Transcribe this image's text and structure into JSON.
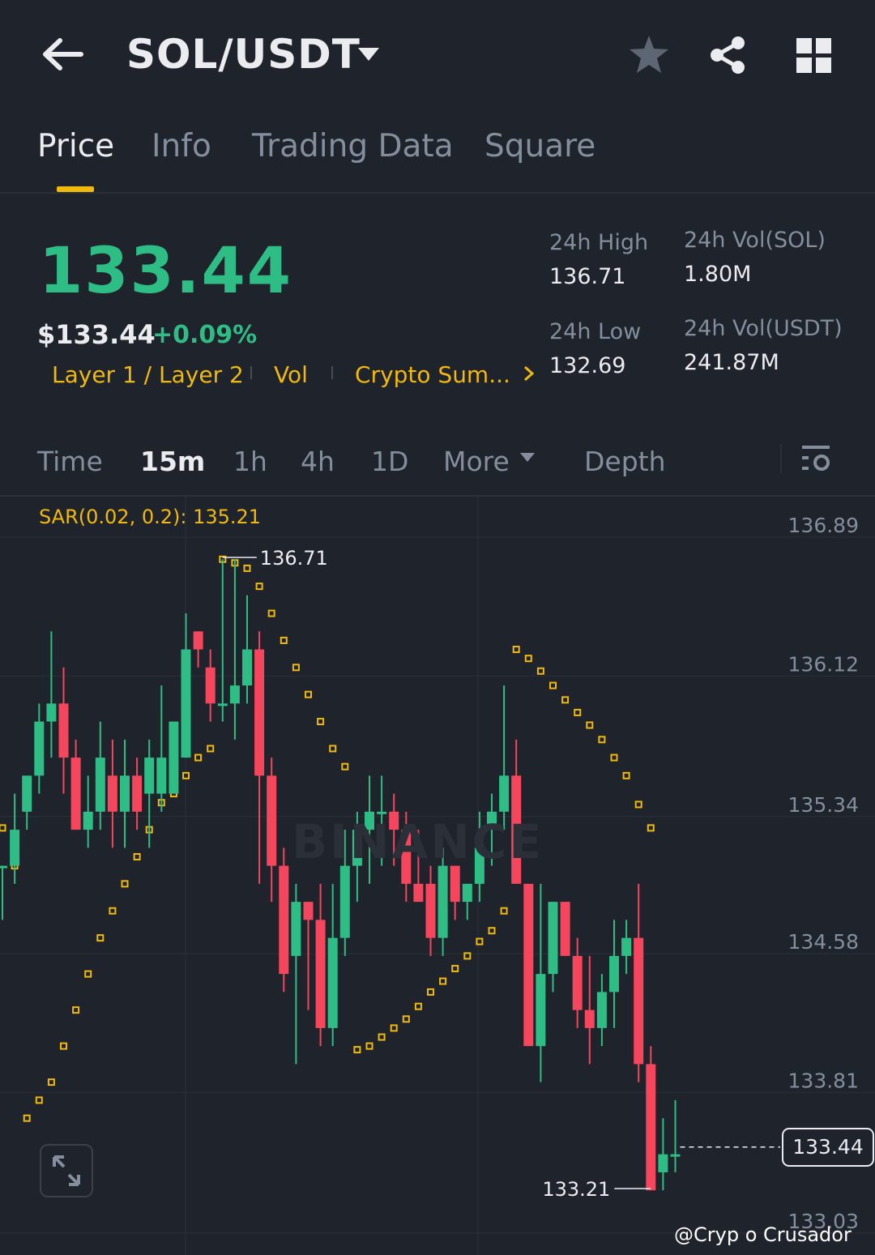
{
  "header": {
    "pair": "SOL/USDT",
    "icons": [
      "back-arrow-icon",
      "dropdown-caret-icon",
      "star-icon",
      "share-icon",
      "grid-menu-icon"
    ]
  },
  "tabs": [
    {
      "label": "Price",
      "active": true
    },
    {
      "label": "Info",
      "active": false
    },
    {
      "label": "Trading Data",
      "active": false
    },
    {
      "label": "Square",
      "active": false
    }
  ],
  "ticker": {
    "last_price": "133.44",
    "usd_price": "$133.44",
    "change": "+0.09%",
    "tags": [
      "Layer 1 / Layer 2",
      "Vol",
      "Crypto Sum..."
    ],
    "stats": {
      "high_label": "24h High",
      "high_value": "136.71",
      "low_label": "24h Low",
      "low_value": "132.69",
      "vol_sol_label": "24h Vol(SOL)",
      "vol_sol_value": "1.80M",
      "vol_usdt_label": "24h Vol(USDT)",
      "vol_usdt_value": "241.87M"
    }
  },
  "intervals": [
    {
      "label": "Time",
      "active": false
    },
    {
      "label": "15m",
      "active": true
    },
    {
      "label": "1h",
      "active": false
    },
    {
      "label": "4h",
      "active": false
    },
    {
      "label": "1D",
      "active": false
    },
    {
      "label": "More",
      "active": false
    },
    {
      "label": "Depth",
      "active": false
    }
  ],
  "colors": {
    "up": "#2ebd85",
    "down": "#f6465d",
    "accent": "#f0b90b",
    "bg": "#1f232b"
  },
  "chart_data": {
    "type": "candlestick",
    "indicator": "SAR(0.02, 0.2): 135.21",
    "y_ticks": [
      "136.89",
      "136.12",
      "135.34",
      "134.58",
      "133.81",
      "133.03"
    ],
    "ylim": [
      132.95,
      137.08
    ],
    "high_marker": "136.71",
    "low_marker": "133.21",
    "current_price": "133.44",
    "candles": [
      {
        "o": 135.0,
        "h": 135.0,
        "l": 134.7,
        "c": 135.0
      },
      {
        "o": 135.0,
        "h": 135.4,
        "l": 134.9,
        "c": 135.2
      },
      {
        "o": 135.3,
        "h": 135.5,
        "l": 135.2,
        "c": 135.5
      },
      {
        "o": 135.5,
        "h": 135.9,
        "l": 135.4,
        "c": 135.8
      },
      {
        "o": 135.8,
        "h": 136.3,
        "l": 135.6,
        "c": 135.9
      },
      {
        "o": 135.9,
        "h": 136.1,
        "l": 135.4,
        "c": 135.6
      },
      {
        "o": 135.6,
        "h": 135.7,
        "l": 135.2,
        "c": 135.2
      },
      {
        "o": 135.2,
        "h": 135.5,
        "l": 135.1,
        "c": 135.3
      },
      {
        "o": 135.3,
        "h": 135.8,
        "l": 135.2,
        "c": 135.6
      },
      {
        "o": 135.5,
        "h": 135.7,
        "l": 135.1,
        "c": 135.3
      },
      {
        "o": 135.3,
        "h": 135.7,
        "l": 135.1,
        "c": 135.5
      },
      {
        "o": 135.5,
        "h": 135.6,
        "l": 135.2,
        "c": 135.3
      },
      {
        "o": 135.4,
        "h": 135.7,
        "l": 135.1,
        "c": 135.6
      },
      {
        "o": 135.4,
        "h": 136.0,
        "l": 135.3,
        "c": 135.6
      },
      {
        "o": 135.4,
        "h": 135.8,
        "l": 135.4,
        "c": 135.8
      },
      {
        "o": 135.6,
        "h": 136.4,
        "l": 135.6,
        "c": 136.2
      },
      {
        "o": 136.3,
        "h": 136.3,
        "l": 136.1,
        "c": 136.2
      },
      {
        "o": 136.1,
        "h": 136.2,
        "l": 135.8,
        "c": 135.9
      },
      {
        "o": 135.9,
        "h": 136.7,
        "l": 135.8,
        "c": 135.9
      },
      {
        "o": 135.9,
        "h": 136.7,
        "l": 135.7,
        "c": 136.0
      },
      {
        "o": 136.0,
        "h": 136.5,
        "l": 135.9,
        "c": 136.2
      },
      {
        "o": 136.2,
        "h": 136.3,
        "l": 134.9,
        "c": 135.5
      },
      {
        "o": 135.5,
        "h": 135.6,
        "l": 134.8,
        "c": 135.0
      },
      {
        "o": 135.0,
        "h": 135.1,
        "l": 134.3,
        "c": 134.4
      },
      {
        "o": 134.5,
        "h": 134.9,
        "l": 133.9,
        "c": 134.8
      },
      {
        "o": 134.8,
        "h": 134.8,
        "l": 134.2,
        "c": 134.7
      },
      {
        "o": 134.7,
        "h": 134.9,
        "l": 134.0,
        "c": 134.1
      },
      {
        "o": 134.1,
        "h": 134.9,
        "l": 134.0,
        "c": 134.6
      },
      {
        "o": 134.6,
        "h": 135.2,
        "l": 134.5,
        "c": 135.0
      },
      {
        "o": 135.0,
        "h": 135.3,
        "l": 134.8,
        "c": 135.2
      },
      {
        "o": 135.2,
        "h": 135.5,
        "l": 134.9,
        "c": 135.3
      },
      {
        "o": 135.3,
        "h": 135.5,
        "l": 135.0,
        "c": 135.3
      },
      {
        "o": 135.3,
        "h": 135.4,
        "l": 135.0,
        "c": 135.2
      },
      {
        "o": 135.2,
        "h": 135.3,
        "l": 134.8,
        "c": 134.9
      },
      {
        "o": 134.9,
        "h": 135.2,
        "l": 134.8,
        "c": 134.8
      },
      {
        "o": 134.9,
        "h": 135.0,
        "l": 134.5,
        "c": 134.6
      },
      {
        "o": 134.6,
        "h": 135.1,
        "l": 134.5,
        "c": 135.0
      },
      {
        "o": 135.0,
        "h": 135.0,
        "l": 134.7,
        "c": 134.8
      },
      {
        "o": 134.8,
        "h": 134.9,
        "l": 134.7,
        "c": 134.9
      },
      {
        "o": 134.9,
        "h": 135.3,
        "l": 134.8,
        "c": 135.1
      },
      {
        "o": 135.2,
        "h": 135.4,
        "l": 135.0,
        "c": 135.3
      },
      {
        "o": 135.3,
        "h": 136.0,
        "l": 135.2,
        "c": 135.5
      },
      {
        "o": 135.5,
        "h": 135.7,
        "l": 134.9,
        "c": 134.9
      },
      {
        "o": 134.9,
        "h": 134.9,
        "l": 134.0,
        "c": 134.0
      },
      {
        "o": 134.0,
        "h": 134.9,
        "l": 133.8,
        "c": 134.4
      },
      {
        "o": 134.4,
        "h": 134.8,
        "l": 134.3,
        "c": 134.8
      },
      {
        "o": 134.8,
        "h": 134.8,
        "l": 134.5,
        "c": 134.5
      },
      {
        "o": 134.5,
        "h": 134.6,
        "l": 134.1,
        "c": 134.2
      },
      {
        "o": 134.2,
        "h": 134.5,
        "l": 133.9,
        "c": 134.1
      },
      {
        "o": 134.1,
        "h": 134.4,
        "l": 134.0,
        "c": 134.3
      },
      {
        "o": 134.3,
        "h": 134.7,
        "l": 134.1,
        "c": 134.5
      },
      {
        "o": 134.5,
        "h": 134.7,
        "l": 134.4,
        "c": 134.6
      },
      {
        "o": 134.6,
        "h": 134.9,
        "l": 133.8,
        "c": 133.9
      },
      {
        "o": 133.9,
        "h": 134.0,
        "l": 133.2,
        "c": 133.2
      },
      {
        "o": 133.3,
        "h": 133.6,
        "l": 133.2,
        "c": 133.4
      },
      {
        "o": 133.4,
        "h": 133.7,
        "l": 133.3,
        "c": 133.4
      }
    ],
    "sar": [
      [
        0,
        135.21
      ],
      [
        1,
        135.0
      ],
      [
        2,
        133.6
      ],
      [
        3,
        133.7
      ],
      [
        4,
        133.8
      ],
      [
        5,
        134.0
      ],
      [
        6,
        134.2
      ],
      [
        7,
        134.4
      ],
      [
        8,
        134.6
      ],
      [
        9,
        134.75
      ],
      [
        10,
        134.9
      ],
      [
        11,
        135.05
      ],
      [
        12,
        135.2
      ],
      [
        13,
        135.35
      ],
      [
        14,
        135.4
      ],
      [
        15,
        135.5
      ],
      [
        16,
        135.6
      ],
      [
        17,
        135.65
      ],
      [
        18,
        136.7
      ],
      [
        19,
        136.68
      ],
      [
        20,
        136.65
      ],
      [
        21,
        136.55
      ],
      [
        22,
        136.4
      ],
      [
        23,
        136.25
      ],
      [
        24,
        136.1
      ],
      [
        25,
        135.95
      ],
      [
        26,
        135.8
      ],
      [
        27,
        135.65
      ],
      [
        28,
        135.55
      ],
      [
        29,
        133.98
      ],
      [
        30,
        134.0
      ],
      [
        31,
        134.05
      ],
      [
        32,
        134.1
      ],
      [
        33,
        134.15
      ],
      [
        34,
        134.22
      ],
      [
        35,
        134.3
      ],
      [
        36,
        134.36
      ],
      [
        37,
        134.43
      ],
      [
        38,
        134.5
      ],
      [
        39,
        134.58
      ],
      [
        40,
        134.64
      ],
      [
        41,
        134.75
      ],
      [
        42,
        136.2
      ],
      [
        43,
        136.15
      ],
      [
        44,
        136.08
      ],
      [
        45,
        136.0
      ],
      [
        46,
        135.92
      ],
      [
        47,
        135.85
      ],
      [
        48,
        135.78
      ],
      [
        49,
        135.7
      ],
      [
        50,
        135.6
      ],
      [
        51,
        135.5
      ],
      [
        52,
        135.34
      ],
      [
        53,
        135.21
      ]
    ]
  },
  "watermark": {
    "handle": "@Cryp  o Crusador",
    "brand": "BINANCE"
  }
}
